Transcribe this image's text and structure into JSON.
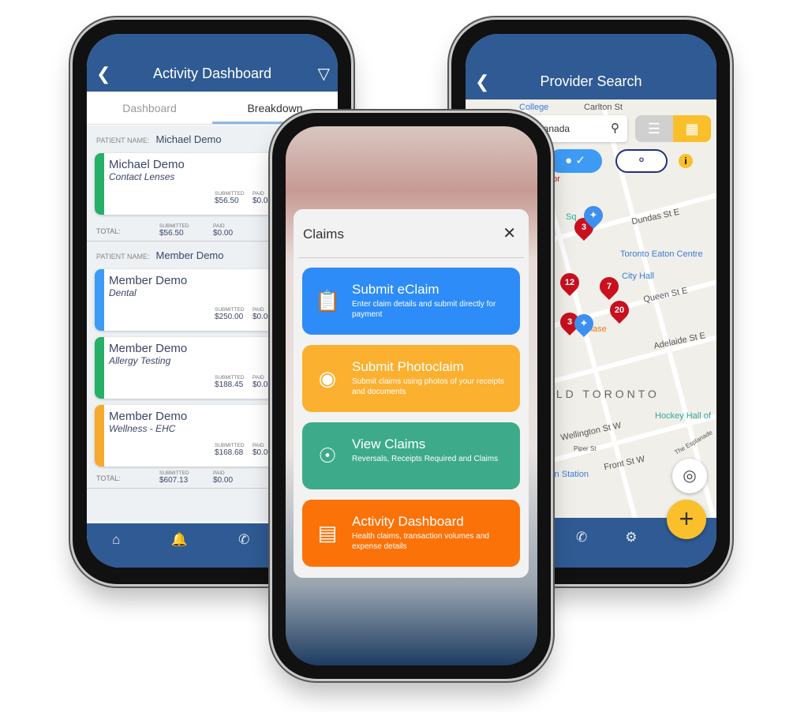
{
  "left_phone": {
    "header": {
      "title": "Activity Dashboard",
      "back_icon": "chevron-left-icon",
      "filter_icon": "filter-icon"
    },
    "tabs": [
      {
        "label": "Dashboard",
        "active": false
      },
      {
        "label": "Breakdown",
        "active": true
      }
    ],
    "patient_label": "PATIENT NAME:",
    "total_label": "TOTAL:",
    "submitted_label": "SUBMITTED",
    "paid_label": "PAID",
    "groups": [
      {
        "patient": "Michael Demo",
        "claims": [
          {
            "name": "Michael Demo",
            "category": "Contact Lenses",
            "submitted": "$56.50",
            "paid": "$0.00",
            "color": "#27b067"
          }
        ],
        "total_submitted": "$56.50",
        "total_paid": "$0.00"
      },
      {
        "patient": "Member Demo",
        "claims": [
          {
            "name": "Member Demo",
            "category": "Dental",
            "submitted": "$250.00",
            "paid": "$0.00",
            "color": "#3d9bf5"
          },
          {
            "name": "Member Demo",
            "category": "Allergy Testing",
            "submitted": "$188.45",
            "paid": "$0.00",
            "color": "#27b067"
          },
          {
            "name": "Member Demo",
            "category": "Wellness - EHC",
            "submitted": "$168.68",
            "paid": "$0.00",
            "color": "#f5a92e"
          }
        ],
        "total_submitted": "$607.13",
        "total_paid": "$0.00"
      }
    ],
    "nav_icons": [
      "home-icon",
      "bell-icon",
      "phone-icon",
      "gear-icon"
    ]
  },
  "modal": {
    "title": "Claims",
    "options": [
      {
        "title": "Submit eClaim",
        "desc": "Enter claim details and submit directly for payment",
        "color": "#2d8cf7",
        "icon": "clipboard-icon"
      },
      {
        "title": "Submit Photoclaim",
        "desc": "Submit claims using photos of your receipts and documents",
        "color": "#fbb030",
        "icon": "camera-icon"
      },
      {
        "title": "View Claims",
        "desc": "Reversals, Receipts Required and Claims",
        "color": "#3dab8a",
        "icon": "eye-icon"
      },
      {
        "title": "Activity Dashboard",
        "desc": "Health claims, transaction volumes and expense details",
        "color": "#fb7209",
        "icon": "bar-chart-icon"
      }
    ]
  },
  "right_phone": {
    "header": {
      "title": "Provider Search"
    },
    "search": {
      "value": "Canada"
    },
    "map_labels": {
      "college": "College",
      "carlton": "Carlton St",
      "dundas": "Dundas St E",
      "eaton": "Toronto Eaton Centre",
      "city_hall": "City Hall",
      "queen": "Queen St E",
      "chase": "Chase",
      "adelaide": "Adelaide St E",
      "old_toronto": "OLD TORONTO",
      "hockey": "Hockey Hall of",
      "wellington": "Wellington St W",
      "piper": "Piper St",
      "front": "Front St W",
      "station": "ion Station",
      "esplanade": "The Esplanade",
      "sq": "Sq",
      "for": "for"
    },
    "pins": [
      "3",
      "12",
      "7",
      "20",
      "3"
    ],
    "nav_icons": [
      "phone-icon",
      "gear-icon"
    ],
    "accent": "#f9c02c"
  }
}
